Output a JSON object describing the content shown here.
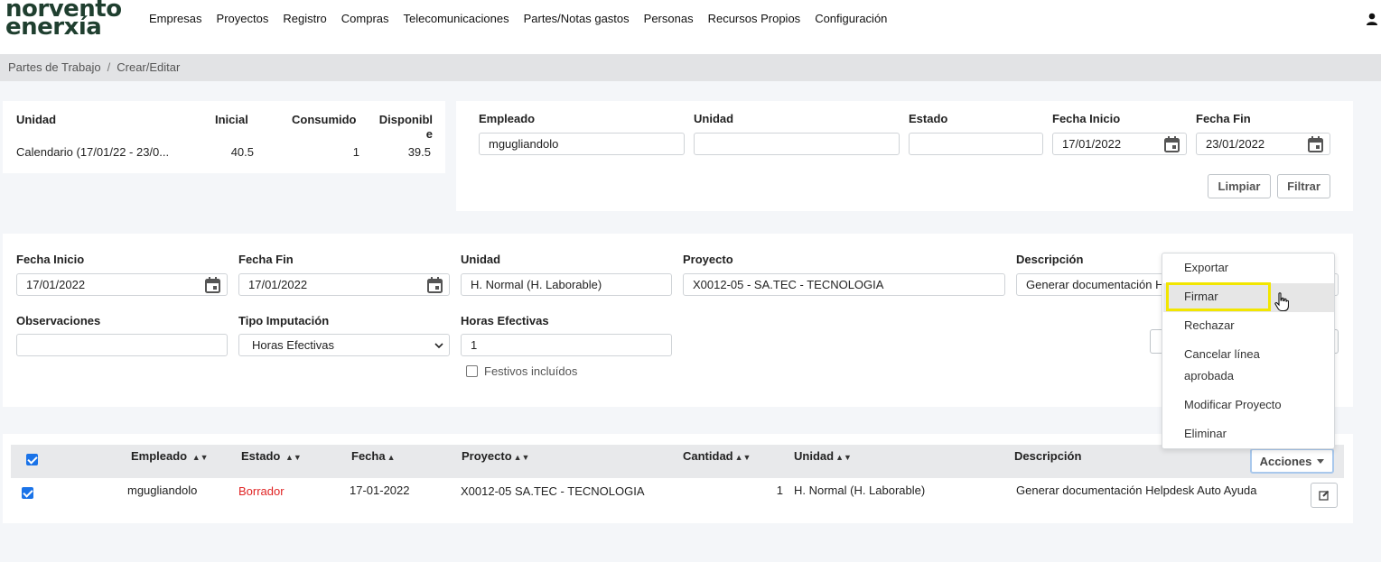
{
  "brand": {
    "line1": "norvento",
    "line2": "enerxía"
  },
  "nav": {
    "items": [
      "Empresas",
      "Proyectos",
      "Registro",
      "Compras",
      "Telecomunicaciones",
      "Partes/Notas gastos",
      "Personas",
      "Recursos Propios",
      "Configuración"
    ]
  },
  "breadcrumb": {
    "parent": "Partes de Trabajo",
    "separator": "/",
    "current": "Crear/Editar"
  },
  "summary": {
    "headers": {
      "unidad": "Unidad",
      "inicial": "Inicial",
      "consumido": "Consumido",
      "disponible": "Disponibl e"
    },
    "row": {
      "unidad": "Calendario (17/01/22 - 23/0...",
      "inicial": "40.5",
      "consumido": "1",
      "disponible": "39.5"
    }
  },
  "filter": {
    "empleado_label": "Empleado",
    "empleado_value": "mgugliandolo",
    "unidad_label": "Unidad",
    "unidad_value": "",
    "estado_label": "Estado",
    "estado_value": "",
    "fecha_inicio_label": "Fecha Inicio",
    "fecha_inicio_value": "17/01/2022",
    "fecha_fin_label": "Fecha Fin",
    "fecha_fin_value": "23/01/2022",
    "limpiar": "Limpiar",
    "filtrar": "Filtrar"
  },
  "form": {
    "fecha_inicio_label": "Fecha Inicio",
    "fecha_inicio_value": "17/01/2022",
    "fecha_fin_label": "Fecha Fin",
    "fecha_fin_value": "17/01/2022",
    "unidad_label": "Unidad",
    "unidad_value": "H. Normal (H. Laborable)",
    "proyecto_label": "Proyecto",
    "proyecto_value": "X0012-05 - SA.TEC - TECNOLOGIA",
    "descripcion_label": "Descripción",
    "descripcion_value": "Generar documentación H",
    "observaciones_label": "Observaciones",
    "observaciones_value": "",
    "tipo_label": "Tipo Imputación",
    "tipo_value": "Horas Efectivas",
    "horas_label": "Horas Efectivas",
    "horas_value": "1",
    "festivos_label": "Festivos incluídos"
  },
  "table": {
    "headers": {
      "empleado": "Empleado",
      "estado": "Estado",
      "fecha": "Fecha",
      "proyecto": "Proyecto",
      "cantidad": "Cantidad",
      "unidad": "Unidad",
      "descripcion": "Descripción",
      "acciones": "Acciones"
    },
    "row": {
      "empleado": "mgugliandolo",
      "estado": "Borrador",
      "fecha": "17-01-2022",
      "proyecto": "X0012-05 SA.TEC - TECNOLOGIA",
      "cantidad": "1",
      "unidad": "H. Normal (H. Laborable)",
      "descripcion": "Generar documentación Helpdesk Auto Ayuda"
    }
  },
  "menu": {
    "items": [
      "Exportar",
      "Firmar",
      "Rechazar",
      "Cancelar línea",
      "aprobada",
      "Modificar Proyecto",
      "Eliminar"
    ]
  },
  "colors": {
    "accent": "#1a73e8",
    "status_draft": "#e02424",
    "brand": "#1f3f2f",
    "highlight": "#f2e600"
  }
}
